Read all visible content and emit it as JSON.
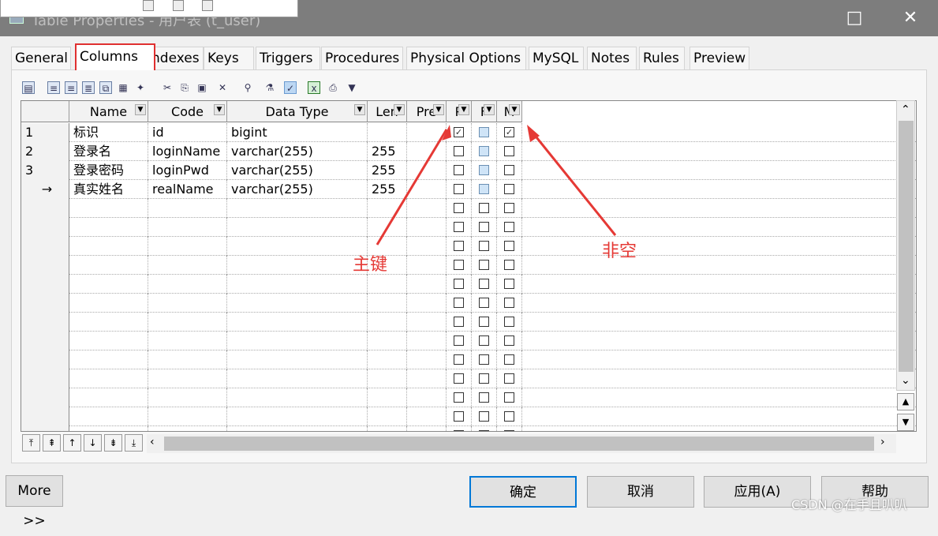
{
  "window": {
    "title": "Table Properties - 用户表 (t_user)",
    "maximize_icon": "□",
    "close_icon": "✕"
  },
  "tabs": [
    "General",
    "Columns",
    "Indexes",
    "Keys",
    "Triggers",
    "Procedures",
    "Physical Options",
    "MySQL",
    "Notes",
    "Rules",
    "Preview"
  ],
  "active_tab": "Columns",
  "toolbar": {
    "icons": [
      "properties-icon",
      "insert-row-icon",
      "add-row-icon",
      "add-rows-icon",
      "reuse-icon",
      "add-icon",
      "add-special-icon",
      "cut-icon",
      "copy-icon",
      "paste-icon",
      "delete-icon",
      "find-icon",
      "filter-icon",
      "customize-columns-icon",
      "excel-icon",
      "print-icon",
      "dropdown-arrow-icon"
    ]
  },
  "grid": {
    "columns": [
      "Name",
      "Code",
      "Data Type",
      "Len",
      "Pre",
      "P",
      "F",
      "M"
    ],
    "rows": [
      {
        "num": "1",
        "name": "标识",
        "code": "id",
        "type": "bigint",
        "len": "",
        "p": true,
        "f": false,
        "m": true
      },
      {
        "num": "2",
        "name": "登录名",
        "code": "loginName",
        "type": "varchar(255)",
        "len": "255",
        "p": false,
        "f": false,
        "m": false
      },
      {
        "num": "3",
        "name": "登录密码",
        "code": "loginPwd",
        "type": "varchar(255)",
        "len": "255",
        "p": false,
        "f": false,
        "m": false
      },
      {
        "num": "→",
        "name": "真实姓名",
        "code": "realName",
        "type": "varchar(255)",
        "len": "255",
        "p": false,
        "f": false,
        "m": false
      }
    ],
    "empty_rows": 13
  },
  "annotations": {
    "primary_key": "主键",
    "not_null": "非空"
  },
  "buttons": {
    "more": "More >>",
    "ok": "确定",
    "cancel": "取消",
    "apply": "应用(A)",
    "help": "帮助"
  },
  "watermark": "CSDN @在手且叭叭",
  "colors": {
    "highlight_red": "#e03030",
    "accent_blue": "#0078d7"
  }
}
